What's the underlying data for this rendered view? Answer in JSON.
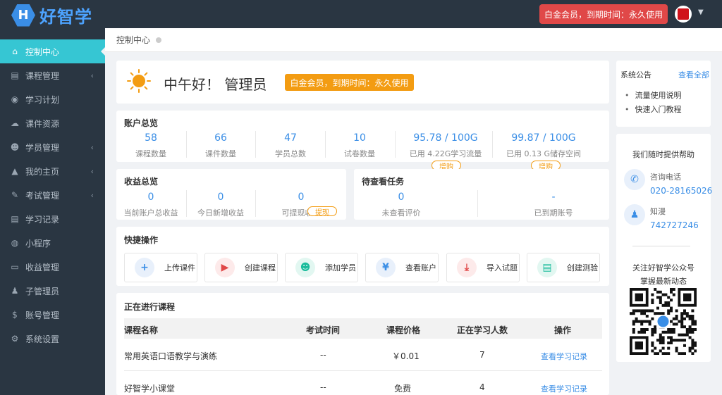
{
  "header": {
    "logo_letter": "H",
    "logo_text": "好智学",
    "vip_label": "白金会员，到期时间：永久使用"
  },
  "sidebar": {
    "items": [
      {
        "label": "控制中心",
        "icon": "home-icon",
        "glyph": "⌂",
        "arrow": false,
        "active": true
      },
      {
        "label": "课程管理",
        "icon": "book-icon",
        "glyph": "▤",
        "arrow": true
      },
      {
        "label": "学习计划",
        "icon": "eye-icon",
        "glyph": "◉",
        "arrow": false
      },
      {
        "label": "课件资源",
        "icon": "cloud-icon",
        "glyph": "☁",
        "arrow": false
      },
      {
        "label": "学员管理",
        "icon": "users-icon",
        "glyph": "☻",
        "arrow": true
      },
      {
        "label": "我的主页",
        "icon": "graduation-cap-icon",
        "glyph": "▲",
        "arrow": true
      },
      {
        "label": "考试管理",
        "icon": "tag-icon",
        "glyph": "✎",
        "arrow": true
      },
      {
        "label": "学习记录",
        "icon": "book-icon",
        "glyph": "▤",
        "arrow": false
      },
      {
        "label": "小程序",
        "icon": "wechat-icon",
        "glyph": "◍",
        "arrow": false
      },
      {
        "label": "收益管理",
        "icon": "card-icon",
        "glyph": "▭",
        "arrow": false
      },
      {
        "label": "子管理员",
        "icon": "user-icon",
        "glyph": "♟",
        "arrow": false
      },
      {
        "label": "账号管理",
        "icon": "dollar-icon",
        "glyph": "$",
        "arrow": false
      },
      {
        "label": "系统设置",
        "icon": "gear-icon",
        "glyph": "⚙",
        "arrow": false
      }
    ]
  },
  "breadcrumb": "控制中心",
  "greeting": {
    "text": "中午好！ 管理员",
    "badge": "白金会员，到期时间：永久使用"
  },
  "account": {
    "title": "账户总览",
    "stats": [
      {
        "num": "58",
        "label": "课程数量"
      },
      {
        "num": "66",
        "label": "课件数量"
      },
      {
        "num": "47",
        "label": "学员总数"
      },
      {
        "num": "10",
        "label": "试卷数量"
      },
      {
        "num": "95.78 / 100G",
        "label": "已用 4.22G学习流量"
      },
      {
        "num": "99.87 / 100G",
        "label": "已用 0.13 G储存空间"
      }
    ],
    "buy_label": "增购"
  },
  "income": {
    "title": "收益总览",
    "stats": [
      {
        "num": "0",
        "label": "当前账户总收益"
      },
      {
        "num": "0",
        "label": "今日新增收益"
      },
      {
        "num": "0",
        "label": "可提现收益"
      }
    ],
    "withdraw_label": "提现"
  },
  "tasks": {
    "title": "待查看任务",
    "stats": [
      {
        "num": "0",
        "label": "未查看评价"
      },
      {
        "num": "-",
        "label": "已到期账号"
      }
    ]
  },
  "quick": {
    "title": "快捷操作",
    "ops": [
      {
        "label": "上传课件",
        "glyph": "+",
        "icon": "plus-icon",
        "bg": "#e8f0fb",
        "fg": "#3a8ee6"
      },
      {
        "label": "创建课程",
        "glyph": "▶",
        "icon": "video-icon",
        "bg": "#fdeaea",
        "fg": "#e04848"
      },
      {
        "label": "添加学员",
        "glyph": "☻",
        "icon": "user-add-icon",
        "bg": "#e2f7f1",
        "fg": "#1abc9c"
      },
      {
        "label": "查看账户",
        "glyph": "¥",
        "icon": "yen-icon",
        "bg": "#e8f0fb",
        "fg": "#3a8ee6"
      },
      {
        "label": "导入试题",
        "glyph": "⤓",
        "icon": "download-icon",
        "bg": "#fdeaea",
        "fg": "#e04848"
      },
      {
        "label": "创建测验",
        "glyph": "▤",
        "icon": "document-icon",
        "bg": "#e2f7f1",
        "fg": "#1abc9c"
      }
    ]
  },
  "courses": {
    "title": "正在进行课程",
    "columns": [
      "课程名称",
      "考试时间",
      "课程价格",
      "正在学习人数",
      "操作"
    ],
    "rows": [
      {
        "name": "常用英语口语教学与演练",
        "exam": "--",
        "price": "￥0.01",
        "learners": "7",
        "action": "查看学习记录"
      },
      {
        "name": "好智学小课堂",
        "exam": "--",
        "price": "免费",
        "learners": "4",
        "action": "查看学习记录"
      }
    ]
  },
  "notice": {
    "title": "系统公告",
    "view_all": "查看全部",
    "items": [
      "流量使用说明",
      "快速入门教程"
    ]
  },
  "help": {
    "title": "我们随时提供帮助",
    "phone_label": "咨询电话",
    "phone": "020-28165026",
    "qq_label": "知漫",
    "qq": "742727246",
    "follow1": "关注好智学公众号",
    "follow2": "掌握最新动态"
  },
  "colors": {
    "accent": "#36c6d3",
    "link": "#3a8ee6",
    "sidebar": "#2a3642",
    "warn": "#f39c12",
    "danger": "#e04848"
  }
}
